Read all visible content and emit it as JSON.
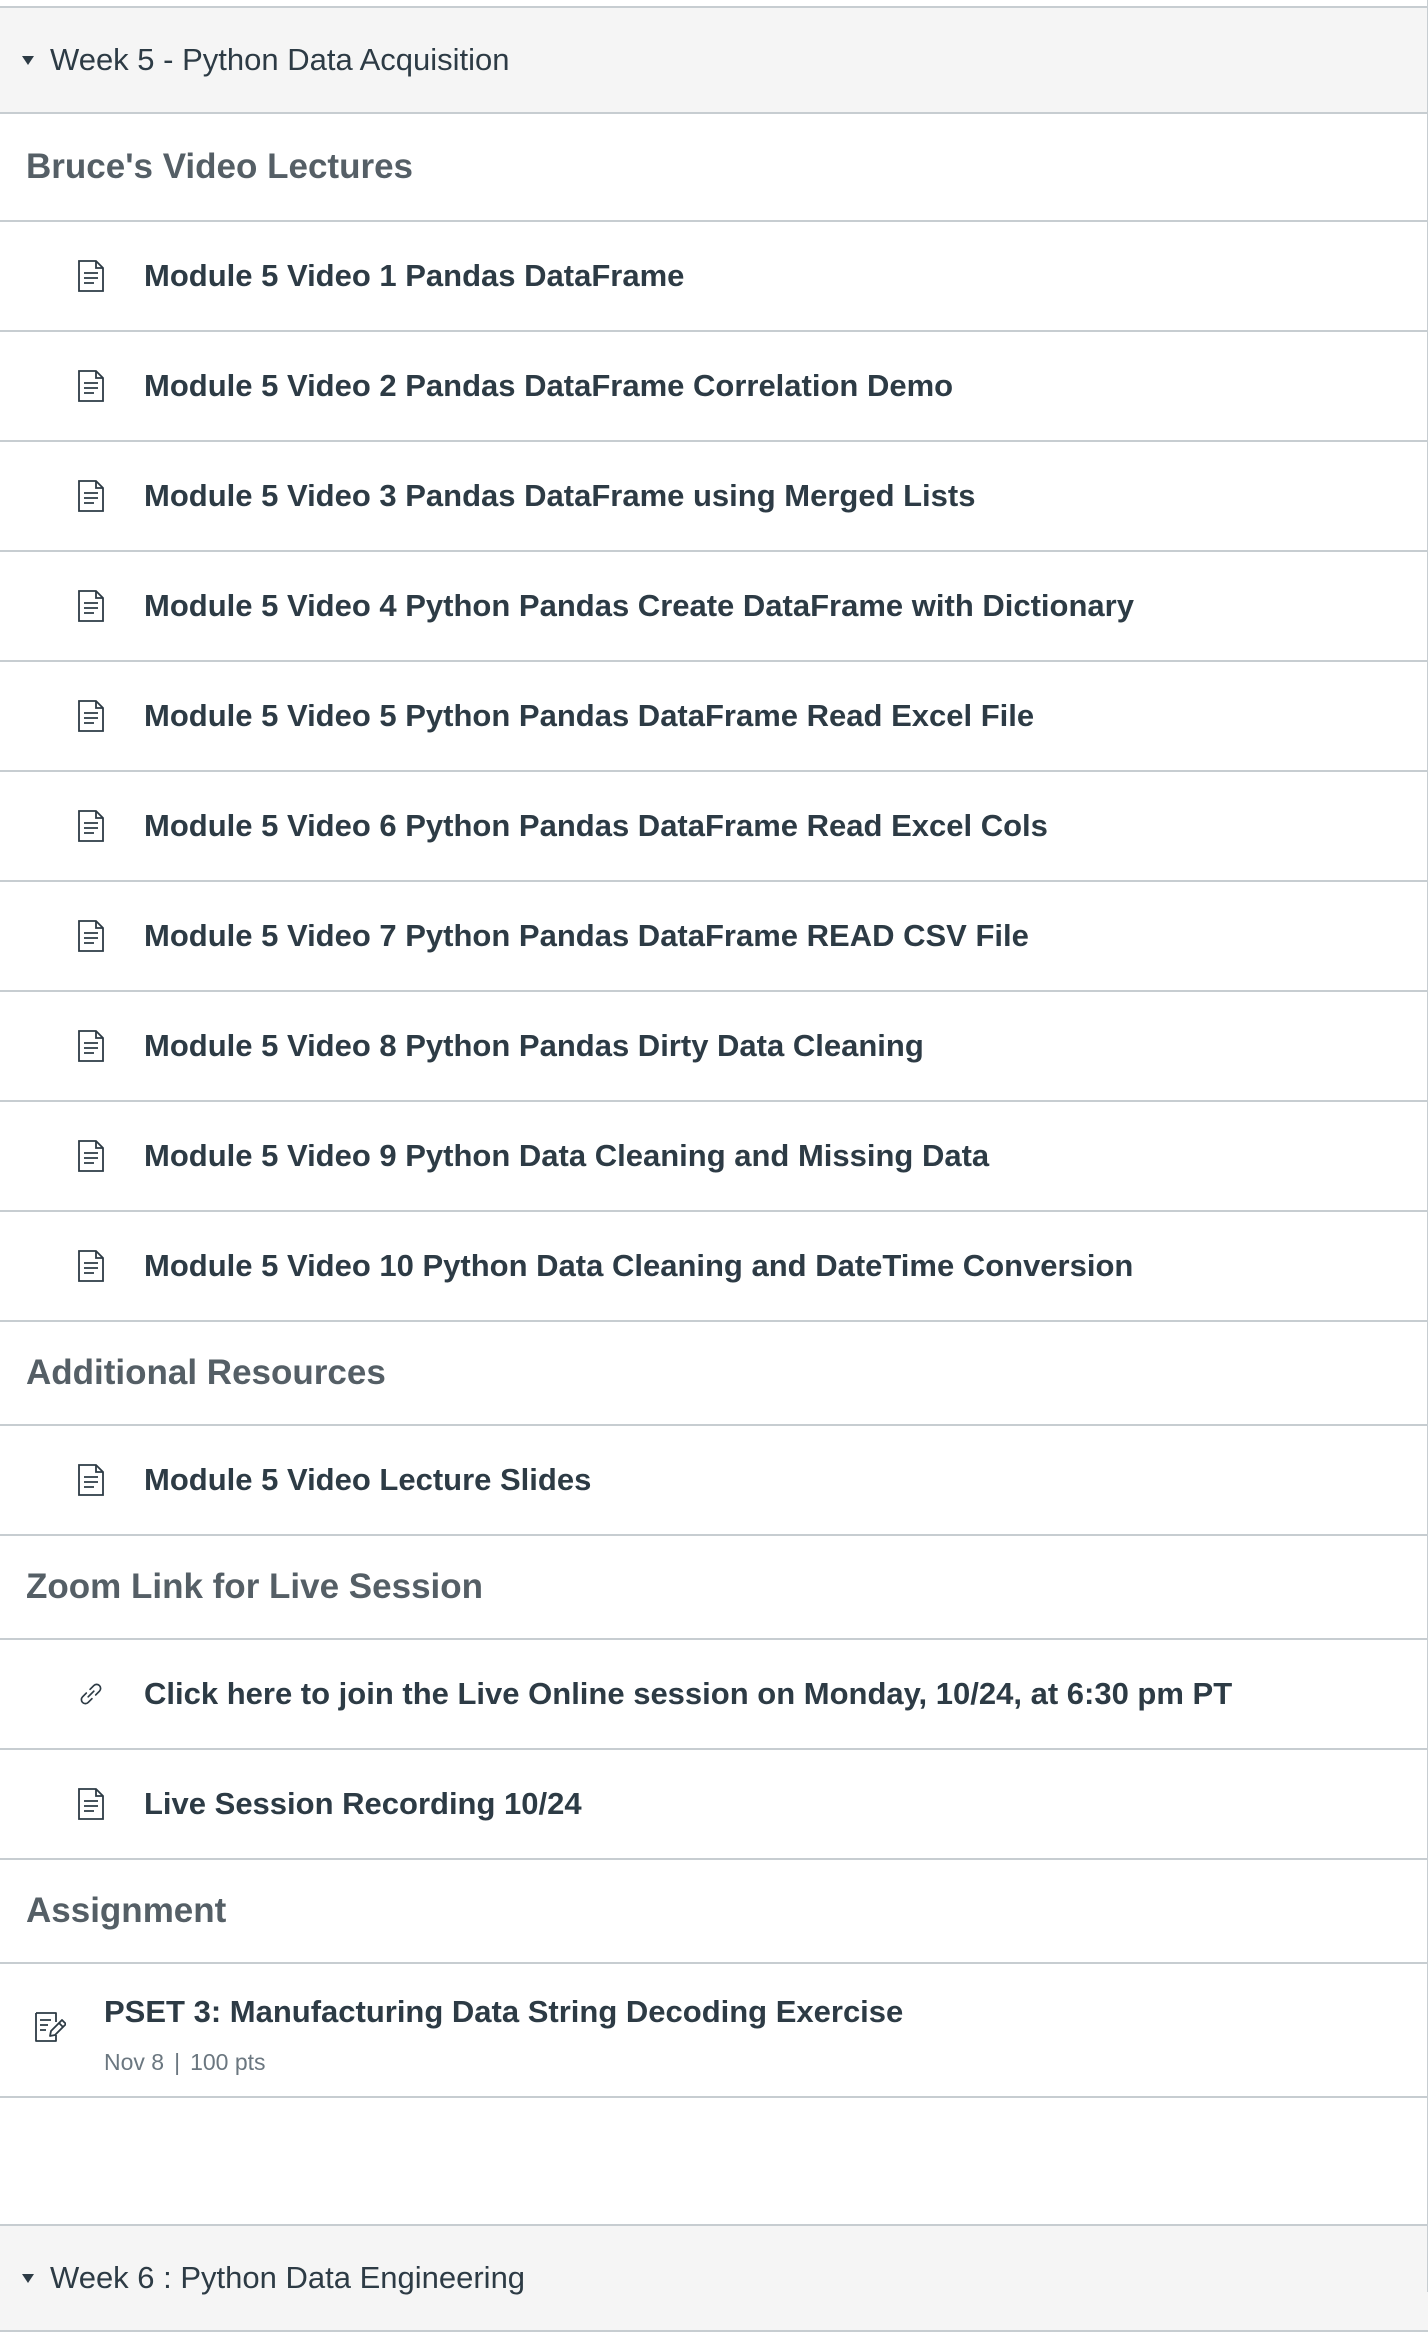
{
  "week5": {
    "title": "Week 5 - Python Data Acquisition"
  },
  "sections": {
    "lectures": "Bruce's Video Lectures",
    "resources": "Additional Resources",
    "zoom": "Zoom Link for Live Session",
    "assignment": "Assignment"
  },
  "lecture_items": [
    {
      "label": "Module 5 Video 1 Pandas DataFrame",
      "icon": "document-icon"
    },
    {
      "label": "Module 5 Video 2 Pandas DataFrame Correlation Demo",
      "icon": "document-icon"
    },
    {
      "label": "Module 5 Video 3 Pandas DataFrame using Merged Lists",
      "icon": "document-icon"
    },
    {
      "label": "Module 5 Video 4 Python Pandas Create DataFrame with Dictionary",
      "icon": "document-icon"
    },
    {
      "label": "Module 5 Video 5 Python Pandas DataFrame Read Excel File",
      "icon": "document-icon"
    },
    {
      "label": "Module 5 Video 6 Python Pandas DataFrame Read Excel Cols",
      "icon": "document-icon"
    },
    {
      "label": "Module 5 Video 7 Python Pandas DataFrame READ CSV File",
      "icon": "document-icon"
    },
    {
      "label": "Module 5 Video 8 Python Pandas Dirty Data Cleaning",
      "icon": "document-icon"
    },
    {
      "label": "Module 5 Video 9 Python Data Cleaning and Missing Data",
      "icon": "document-icon"
    },
    {
      "label": "Module 5 Video 10 Python Data Cleaning and DateTime Conversion",
      "icon": "document-icon"
    }
  ],
  "resource_items": [
    {
      "label": "Module 5 Video Lecture Slides",
      "icon": "document-icon"
    }
  ],
  "zoom_items": [
    {
      "label": "Click here to join the Live Online session on Monday, 10/24, at 6:30 pm PT",
      "icon": "link-icon"
    },
    {
      "label": "Live Session Recording 10/24",
      "icon": "document-icon"
    }
  ],
  "assignment_item": {
    "label": "PSET 3: Manufacturing Data String Decoding Exercise",
    "due": "Nov 8",
    "separator": "|",
    "points": "100 pts",
    "icon": "assignment-icon"
  },
  "week6": {
    "title": "Week 6 : Python Data Engineering"
  }
}
